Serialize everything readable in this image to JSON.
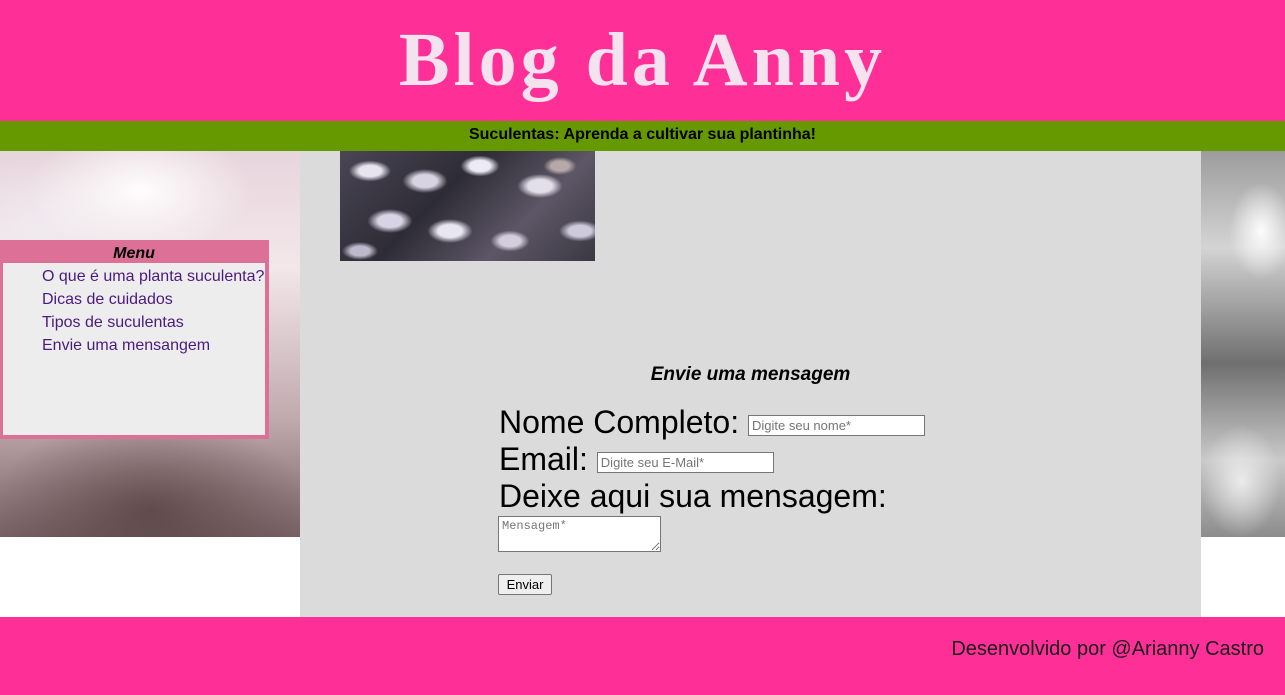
{
  "header": {
    "title": "Blog da Anny"
  },
  "subheader": {
    "text": "Suculentas: Aprenda a cultivar sua plantinha!"
  },
  "menu": {
    "title": "Menu",
    "items": [
      {
        "label": "O que é uma planta suculenta?"
      },
      {
        "label": "Dicas de cuidados"
      },
      {
        "label": "Tipos de suculentas"
      },
      {
        "label": "Envie uma mensangem"
      }
    ]
  },
  "form": {
    "title": "Envie uma mensagem",
    "name_label": "Nome Completo:",
    "name_placeholder": "Digite seu nome*",
    "email_label": "Email:",
    "email_placeholder": "Digite seu E-Mail*",
    "message_label": "Deixe aqui sua mensagem:",
    "message_placeholder": "Mensagem*",
    "submit_label": "Enviar"
  },
  "footer": {
    "text": "Desenvolvido por @Arianny Castro"
  },
  "colors": {
    "header_bg": "#ff2f98",
    "subbar_bg": "#669900",
    "menu_border": "#dd7096",
    "content_bg": "#dbdbdb",
    "link": "#4a1a80"
  }
}
